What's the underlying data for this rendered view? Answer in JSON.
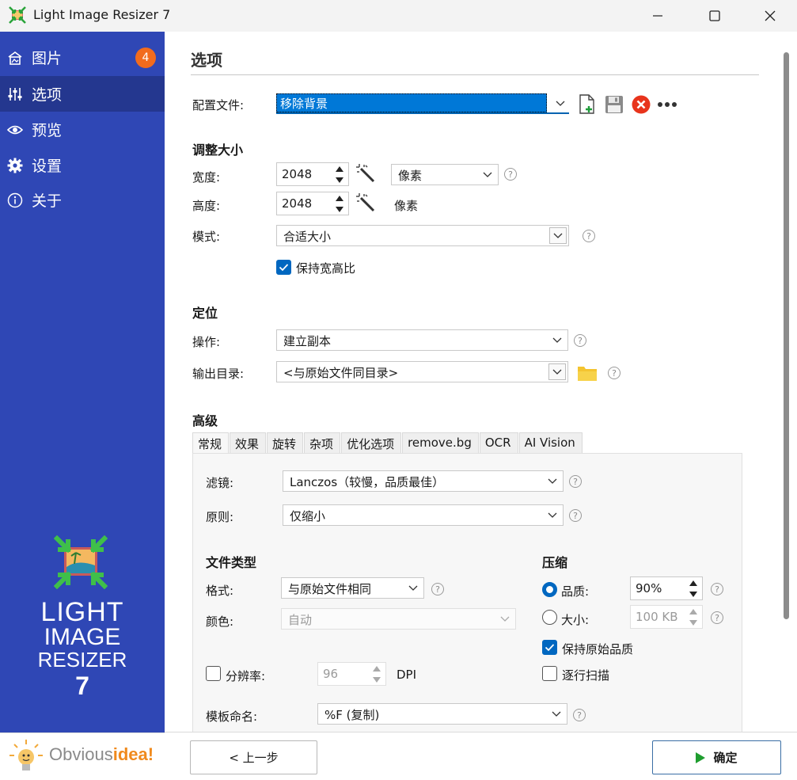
{
  "window": {
    "title": "Light Image Resizer 7",
    "minimize": "—",
    "maximize": "☐",
    "close": "✕"
  },
  "sidebar": {
    "items": [
      {
        "label": "图片",
        "icon": "images-icon",
        "badge": "4"
      },
      {
        "label": "选项",
        "icon": "sliders-icon"
      },
      {
        "label": "预览",
        "icon": "eye-icon"
      },
      {
        "label": "设置",
        "icon": "gear-icon"
      },
      {
        "label": "关于",
        "icon": "info-icon"
      }
    ],
    "logo_lines": [
      "LIGHT",
      "IMAGE",
      "RESIZER",
      "7"
    ],
    "footer_brand_a": "Obvious",
    "footer_brand_b": "idea!"
  },
  "page": {
    "title": "选项",
    "profile_label": "配置文件:",
    "profile_value": "移除背景"
  },
  "resize": {
    "heading": "调整大小",
    "width_label": "宽度:",
    "width_value": "2048",
    "width_unit": "像素",
    "height_label": "高度:",
    "height_value": "2048",
    "height_unit": "像素",
    "mode_label": "模式:",
    "mode_value": "合适大小",
    "keep_ratio_label": "保持宽高比",
    "keep_ratio_checked": true
  },
  "target": {
    "heading": "定位",
    "action_label": "操作:",
    "action_value": "建立副本",
    "output_label": "输出目录:",
    "output_value": "<与原始文件同目录>"
  },
  "advanced": {
    "heading": "高级",
    "tabs": [
      "常规",
      "效果",
      "旋转",
      "杂项",
      "优化选项",
      "remove.bg",
      "OCR",
      "AI Vision"
    ],
    "active_tab": 0,
    "filter_label": "滤镜:",
    "filter_value": "Lanczos（较慢，品质最佳）",
    "rule_label": "原则:",
    "rule_value": "仅缩小",
    "filetype_heading": "文件类型",
    "format_label": "格式:",
    "format_value": "与原始文件相同",
    "color_label": "颜色:",
    "color_value": "自动",
    "resolution_label": "分辨率:",
    "resolution_value": "96",
    "resolution_unit": "DPI",
    "resolution_checked": false,
    "compression_heading": "压缩",
    "quality_label": "品质:",
    "quality_value": "90%",
    "size_label": "大小:",
    "size_value": "100 KB",
    "keep_quality_label": "保持原始品质",
    "keep_quality_checked": true,
    "progressive_label": "逐行扫描",
    "progressive_checked": false,
    "template_label": "模板命名:",
    "template_value": "%F (复制)"
  },
  "footer": {
    "back_label": "< 上一步",
    "ok_label": "确定"
  },
  "colors": {
    "sidebar": "#2f47b5",
    "sidebar_active": "#24378f",
    "badge": "#f26b1d",
    "accent": "#0067c0",
    "ok_arrow": "#1f9d2f",
    "remove_red": "#e8341c",
    "folder_yellow": "#f4c430"
  }
}
